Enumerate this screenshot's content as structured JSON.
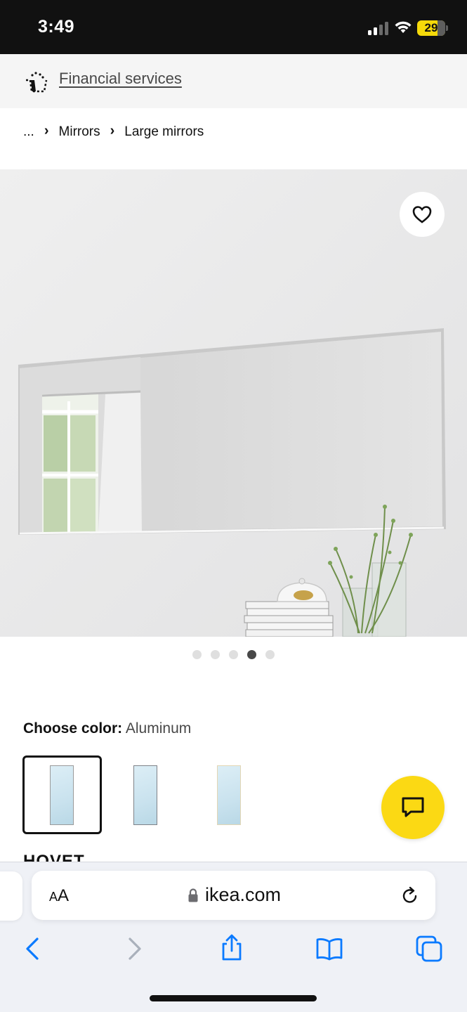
{
  "status_bar": {
    "time": "3:49",
    "battery_level": "29",
    "icons": [
      "cellular-signal-icon",
      "wifi-icon",
      "battery-icon"
    ]
  },
  "financial_banner": {
    "icon": "basket-dotted-icon",
    "link_label": "Financial services"
  },
  "breadcrumb": {
    "items": [
      "...",
      "Mirrors",
      "Large mirrors"
    ],
    "separator_icon": "chevron-right-icon"
  },
  "gallery": {
    "favorite_icon": "heart-outline-icon",
    "image_count": 5,
    "active_index": 3
  },
  "color_picker": {
    "label": "Choose color:",
    "selected_value": "Aluminum",
    "swatches": [
      {
        "name": "aluminum",
        "selected": true,
        "frame_color": "#9a9a9a"
      },
      {
        "name": "dark",
        "selected": false,
        "frame_color": "#7f8288"
      },
      {
        "name": "light",
        "selected": false,
        "frame_color": "#e3d6b3"
      }
    ]
  },
  "next_section_heading": "HOVET",
  "chat": {
    "icon": "chat-bubble-icon",
    "color": "#fbd914"
  },
  "browser": {
    "text_size_label_large": "A",
    "text_size_label_small": "A",
    "url": "ikea.com",
    "toolbar_icons": [
      "back-icon",
      "forward-icon",
      "share-icon",
      "bookmarks-icon",
      "tabs-icon"
    ],
    "accent_color": "#0a7aff"
  }
}
